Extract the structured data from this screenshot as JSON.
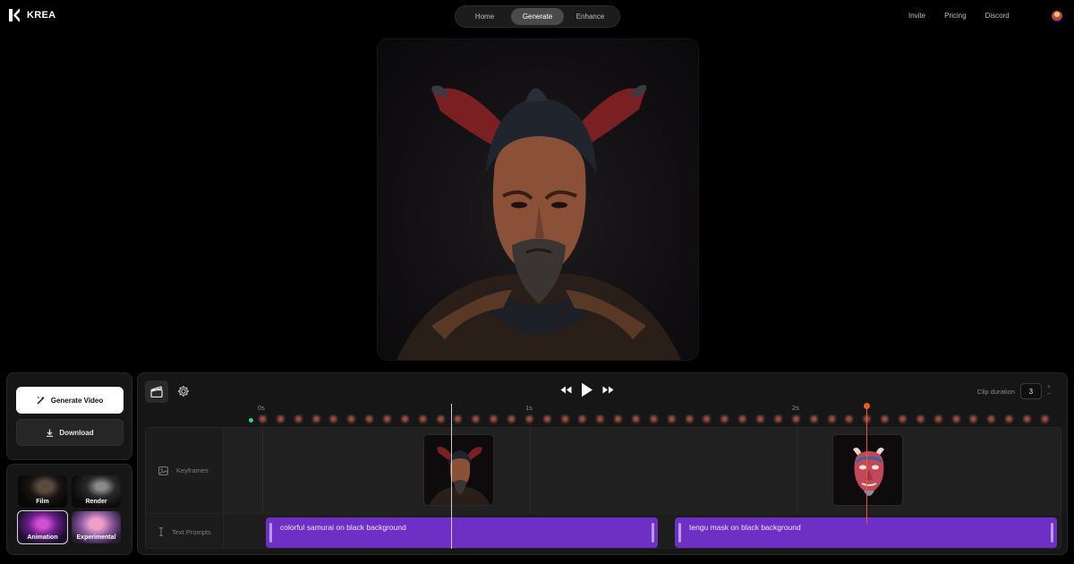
{
  "app": {
    "name": "KREA"
  },
  "nav": {
    "items": [
      "Home",
      "Generate",
      "Enhance"
    ],
    "active": "Generate"
  },
  "top_links": [
    "Invite",
    "Pricing",
    "Discord"
  ],
  "actions": {
    "generate_label": "Generate Video",
    "download_label": "Download"
  },
  "styles": {
    "items": [
      "Film",
      "Render",
      "Animation",
      "Experimental"
    ],
    "selected": "Animation"
  },
  "timeline": {
    "clip_duration_label": "Clip duration",
    "clip_duration": "3",
    "ruler": [
      "0s",
      "1s",
      "2s"
    ],
    "tracks": {
      "keyframes": "Keyframes",
      "text_prompts": "Text Prompts"
    },
    "prompts": [
      "colorful samurai on black background",
      "tengu mask on black background"
    ]
  },
  "colors": {
    "accent": "#6e2fc4",
    "playhead": "#f05a2a",
    "start_marker": "#3ad17a"
  }
}
